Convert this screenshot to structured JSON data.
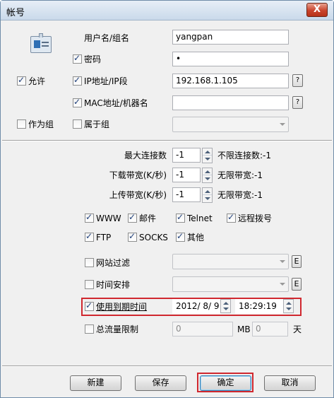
{
  "window": {
    "title": "帐号",
    "close_label": "X"
  },
  "account": {
    "username_label": "用户名/组名",
    "username_value": "yangpan",
    "password_label": "密码",
    "password_value": "•",
    "ip_label": "IP地址/IP段",
    "ip_value": "192.168.1.105",
    "mac_label": "MAC地址/机器名",
    "mac_value": "",
    "allow_label": "允许",
    "as_group_label": "作为组",
    "belongs_label": "属于组",
    "help_label": "?"
  },
  "limits": {
    "max_conn_label": "最大连接数",
    "max_conn_value": "-1",
    "max_conn_hint": "不限连接数:-1",
    "download_label": "下载带宽(K/秒)",
    "download_value": "-1",
    "download_hint": "无限带宽:-1",
    "upload_label": "上传带宽(K/秒)",
    "upload_value": "-1",
    "upload_hint": "无限带宽:-1"
  },
  "services": {
    "www": "WWW",
    "mail": "邮件",
    "telnet": "Telnet",
    "dialup": "远程拨号",
    "ftp": "FTP",
    "socks": "SOCKS",
    "other": "其他"
  },
  "options": {
    "site_filter_label": "网站过滤",
    "schedule_label": "时间安排",
    "expire_label": "使用到期时间",
    "expire_date": "2012/ 8/ 9",
    "expire_time": "18:29:19",
    "traffic_label": "总流量限制",
    "traffic_value": "0",
    "traffic_unit": "MB",
    "traffic_days": "0",
    "days_unit": "天",
    "edit_label": "E"
  },
  "buttons": {
    "new": "新建",
    "save": "保存",
    "ok": "确定",
    "cancel": "取消"
  }
}
